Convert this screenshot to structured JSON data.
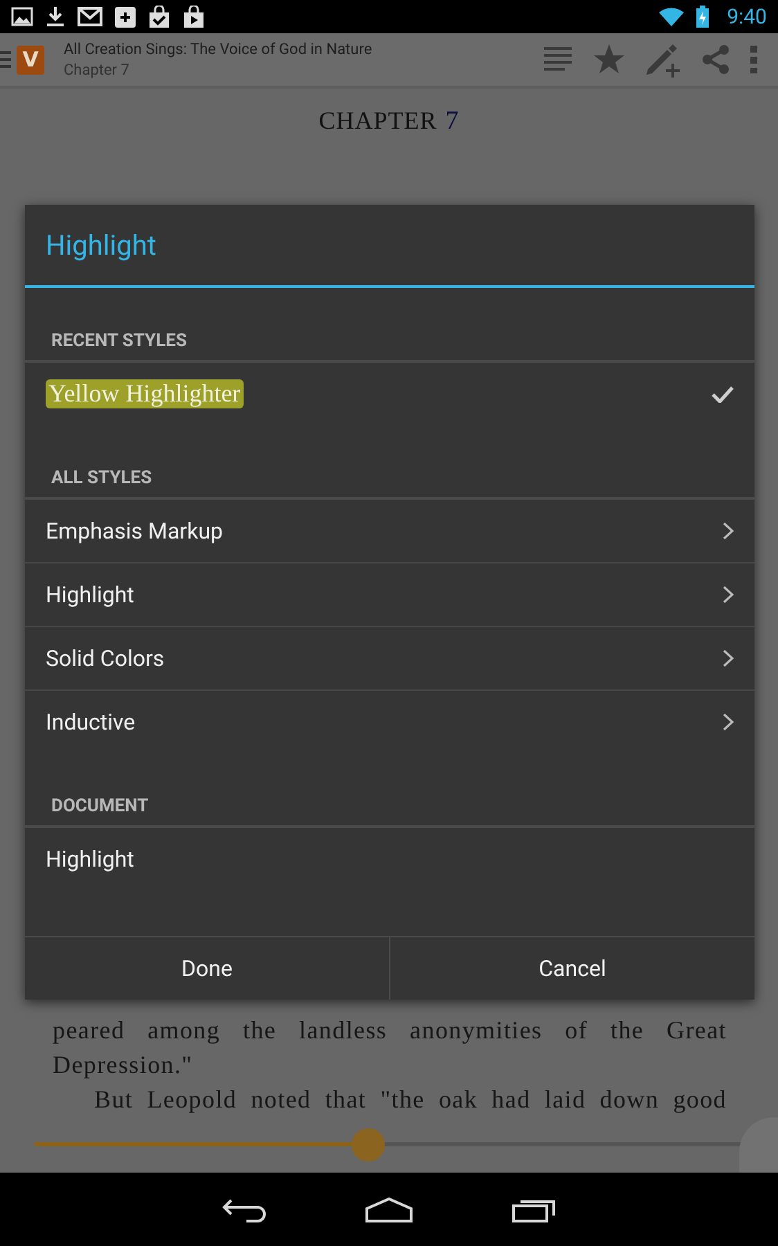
{
  "status_bar": {
    "time": "9:40"
  },
  "app_bar": {
    "logo": "V",
    "title": "All Creation Sings: The Voice of God in Nature",
    "subtitle": "Chapter 7"
  },
  "page": {
    "chapter_label": "CHAPTER",
    "chapter_number": "7",
    "lines": [
      {
        "text": "peared among the landless anonymities of the Great",
        "kind": "justified"
      },
      {
        "text": "Depression.\"",
        "kind": "last"
      },
      {
        "text": "But Leopold noted that \"the oak had laid down good",
        "kind": "first"
      }
    ],
    "progress": {
      "level": 0.47
    }
  },
  "dialog": {
    "title": "Highlight",
    "sections": [
      {
        "header": "RECENT STYLES",
        "rows": [
          {
            "label": "Yellow Highlighter",
            "kind": "swatch",
            "color": "#9da12a",
            "checked": true
          }
        ]
      },
      {
        "header": "ALL STYLES",
        "rows": [
          {
            "label": "Emphasis Markup",
            "kind": "submenu",
            "checked": false
          },
          {
            "label": "Highlight",
            "kind": "submenu",
            "checked": false
          },
          {
            "label": "Solid Colors",
            "kind": "submenu",
            "checked": false
          },
          {
            "label": "Inductive",
            "kind": "submenu",
            "checked": false
          }
        ]
      },
      {
        "header": "DOCUMENT",
        "rows": [
          {
            "label": "Highlight",
            "kind": "plain",
            "checked": false
          }
        ]
      }
    ],
    "buttons": [
      "Done",
      "Cancel"
    ]
  }
}
